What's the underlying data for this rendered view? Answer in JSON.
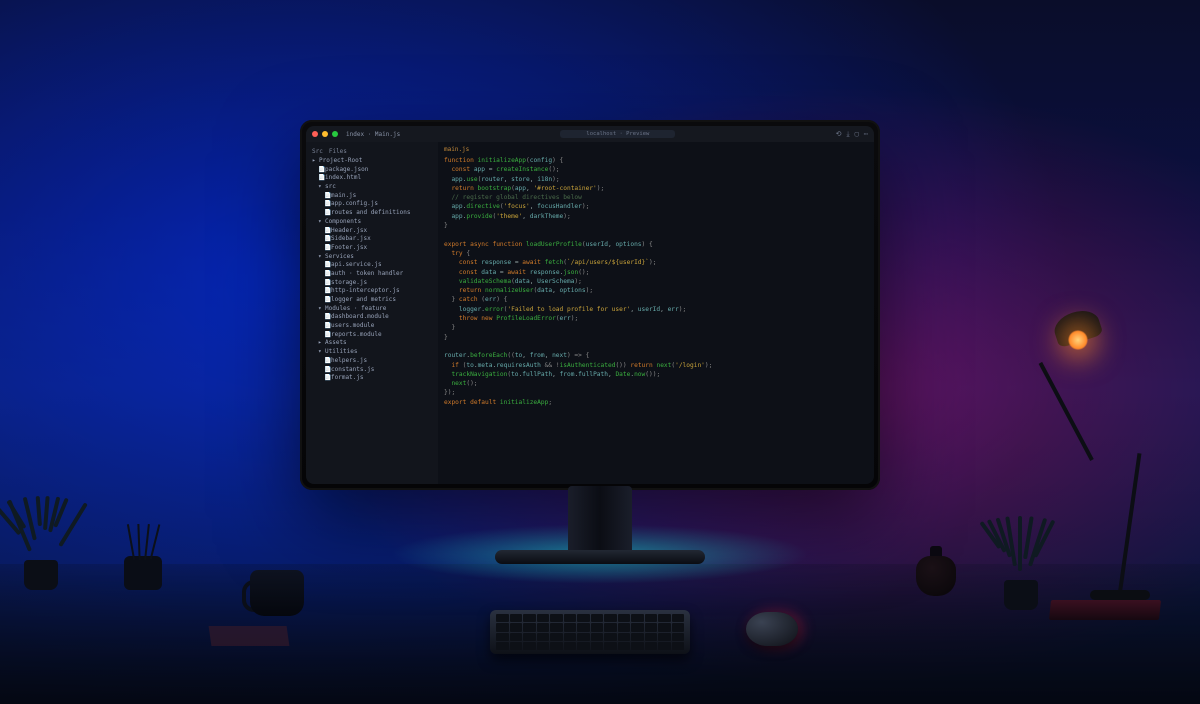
{
  "window": {
    "title": "index · Main.js",
    "address": "localhost · Preview"
  },
  "sidebar": {
    "tabs": [
      "Src",
      "Files"
    ],
    "items": [
      {
        "indent": 0,
        "icon": "▸",
        "label": "Project-Root",
        "kind": "folder"
      },
      {
        "indent": 1,
        "icon": "📄",
        "label": "package.json",
        "kind": "file"
      },
      {
        "indent": 1,
        "icon": "📄",
        "label": "index.html",
        "kind": "file"
      },
      {
        "indent": 1,
        "icon": "▾",
        "label": "src",
        "kind": "folder"
      },
      {
        "indent": 2,
        "icon": "📄",
        "label": "main.js",
        "kind": "file"
      },
      {
        "indent": 2,
        "icon": "📄",
        "label": "app.config.js",
        "kind": "file"
      },
      {
        "indent": 2,
        "icon": "📄",
        "label": "routes and definitions",
        "kind": "file"
      },
      {
        "indent": 1,
        "icon": "▾",
        "label": "Components",
        "kind": "folder"
      },
      {
        "indent": 2,
        "icon": "📄",
        "label": "Header.jsx",
        "kind": "file"
      },
      {
        "indent": 2,
        "icon": "📄",
        "label": "Sidebar.jsx",
        "kind": "file"
      },
      {
        "indent": 2,
        "icon": "📄",
        "label": "Footer.jsx",
        "kind": "file"
      },
      {
        "indent": 1,
        "icon": "▾",
        "label": "Services",
        "kind": "folder"
      },
      {
        "indent": 2,
        "icon": "📄",
        "label": "api.service.js",
        "kind": "file"
      },
      {
        "indent": 2,
        "icon": "📄",
        "label": "auth · token handler",
        "kind": "file"
      },
      {
        "indent": 2,
        "icon": "📄",
        "label": "storage.js",
        "kind": "file"
      },
      {
        "indent": 2,
        "icon": "📄",
        "label": "http-interceptor.js",
        "kind": "file"
      },
      {
        "indent": 2,
        "icon": "📄",
        "label": "logger and metrics",
        "kind": "file"
      },
      {
        "indent": 1,
        "icon": "▾",
        "label": "Modules · feature",
        "kind": "folder"
      },
      {
        "indent": 2,
        "icon": "📄",
        "label": "dashboard.module",
        "kind": "file"
      },
      {
        "indent": 2,
        "icon": "📄",
        "label": "users.module",
        "kind": "file"
      },
      {
        "indent": 2,
        "icon": "📄",
        "label": "reports.module",
        "kind": "file"
      },
      {
        "indent": 1,
        "icon": "▸",
        "label": "Assets",
        "kind": "folder"
      },
      {
        "indent": 1,
        "icon": "▾",
        "label": "Utilities",
        "kind": "folder"
      },
      {
        "indent": 2,
        "icon": "📄",
        "label": "helpers.js",
        "kind": "file"
      },
      {
        "indent": 2,
        "icon": "📄",
        "label": "constants.js",
        "kind": "file"
      },
      {
        "indent": 2,
        "icon": "📄",
        "label": "format.js",
        "kind": "file"
      }
    ]
  },
  "editor": {
    "open_tab": "main.js",
    "code_html": "<span class='k'>function</span> <span class='fn'>initializeApp</span><span class='p'>(</span><span class='v'>config</span><span class='p'>) {</span>\n  <span class='k'>const</span> <span class='v'>app</span> = <span class='fn'>createInstance</span><span class='p'>();</span>\n  <span class='v'>app</span>.<span class='fn'>use</span><span class='p'>(</span><span class='v'>router</span>, <span class='v'>store</span>, <span class='v'>i18n</span><span class='p'>);</span>\n  <span class='k'>return</span> <span class='fn'>bootstrap</span><span class='p'>(</span><span class='v'>app</span>, <span class='s'>'#root-container'</span><span class='p'>);</span>\n  <span class='c'>// register global directives below</span>\n  <span class='v'>app</span>.<span class='fn'>directive</span><span class='p'>(</span><span class='s'>'focus'</span>, <span class='v'>focusHandler</span><span class='p'>);</span>\n  <span class='v'>app</span>.<span class='fn'>provide</span><span class='p'>(</span><span class='s'>'theme'</span>, <span class='v'>darkTheme</span><span class='p'>);</span>\n<span class='p'>}</span>\n\n<span class='k'>export</span> <span class='k'>async</span> <span class='k'>function</span> <span class='fn'>loadUserProfile</span><span class='p'>(</span><span class='v'>userId</span>, <span class='v'>options</span><span class='p'>) {</span>\n  <span class='k'>try</span> <span class='p'>{</span>\n    <span class='k'>const</span> <span class='v'>response</span> = <span class='k'>await</span> <span class='fn'>fetch</span><span class='p'>(</span><span class='s'>`/api/users/${userId}`</span><span class='p'>);</span>\n    <span class='k'>const</span> <span class='v'>data</span> = <span class='k'>await</span> <span class='v'>response</span>.<span class='fn'>json</span><span class='p'>();</span>\n    <span class='fn'>validateSchema</span><span class='p'>(</span><span class='v'>data</span>, <span class='v'>UserSchema</span><span class='p'>);</span>\n    <span class='k'>return</span> <span class='fn'>normalizeUser</span><span class='p'>(</span><span class='v'>data</span>, <span class='v'>options</span><span class='p'>);</span>\n  <span class='p'>}</span> <span class='k'>catch</span> <span class='p'>(</span><span class='v'>err</span><span class='p'>) {</span>\n    <span class='v'>logger</span>.<span class='fn'>error</span><span class='p'>(</span><span class='s'>'Failed to load profile for user'</span>, <span class='v'>userId</span>, <span class='v'>err</span><span class='p'>);</span>\n    <span class='k'>throw</span> <span class='k'>new</span> <span class='fn'>ProfileLoadError</span><span class='p'>(</span><span class='v'>err</span><span class='p'>);</span>\n  <span class='p'>}</span>\n<span class='p'>}</span>\n\n<span class='v'>router</span>.<span class='fn'>beforeEach</span><span class='p'>((</span><span class='v'>to</span>, <span class='v'>from</span>, <span class='v'>next</span><span class='p'>) =&gt; {</span>\n  <span class='k'>if</span> <span class='p'>(</span><span class='v'>to</span>.<span class='v'>meta</span>.<span class='v'>requiresAuth</span> <span class='p'>&amp;&amp;</span> <span class='p'>!</span><span class='fn'>isAuthenticated</span><span class='p'>())</span> <span class='k'>return</span> <span class='fn'>next</span><span class='p'>(</span><span class='s'>'/login'</span><span class='p'>);</span>\n  <span class='fn'>trackNavigation</span><span class='p'>(</span><span class='v'>to</span>.<span class='v'>fullPath</span>, <span class='v'>from</span>.<span class='v'>fullPath</span>, <span class='fn'>Date</span>.<span class='fn'>now</span><span class='p'>());</span>\n  <span class='fn'>next</span><span class='p'>();</span>\n<span class='p'>});</span>\n<span class='k'>export</span> <span class='k'>default</span> <span class='fn'>initializeApp</span><span class='p'>;</span>"
  },
  "top_icons": [
    "⟲",
    "⤓",
    "▢",
    "⋯"
  ]
}
